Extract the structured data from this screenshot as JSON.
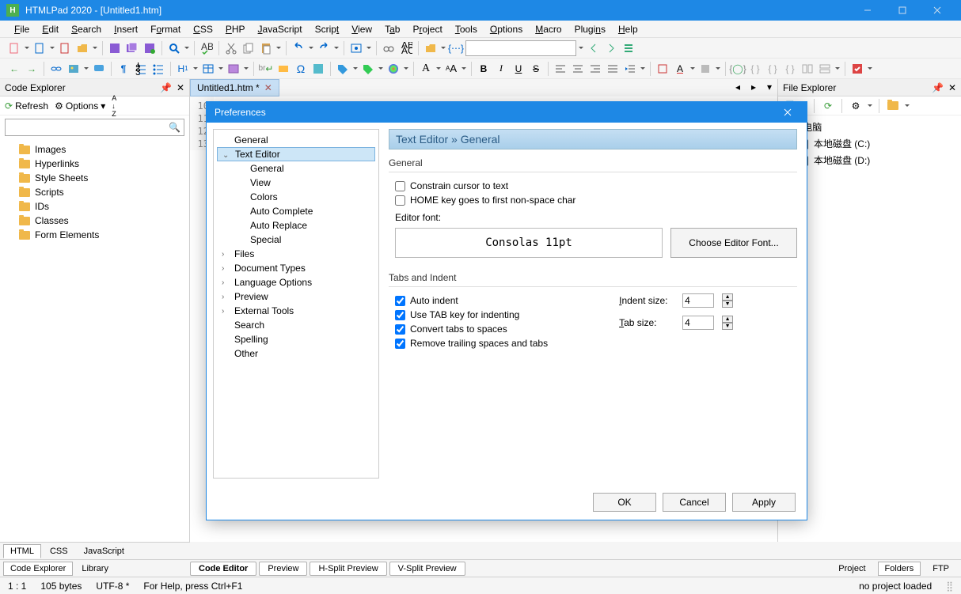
{
  "title": "HTMLPad 2020 - [Untitled1.htm]",
  "menu": [
    "File",
    "Edit",
    "Search",
    "Insert",
    "Format",
    "CSS",
    "PHP",
    "JavaScript",
    "Script",
    "View",
    "Tab",
    "Project",
    "Tools",
    "Options",
    "Macro",
    "Plugins",
    "Help"
  ],
  "code_explorer": {
    "title": "Code Explorer",
    "refresh": "Refresh",
    "options": "Options",
    "sort": "A↓Z",
    "items": [
      "Images",
      "Hyperlinks",
      "Style Sheets",
      "Scripts",
      "IDs",
      "Classes",
      "Form Elements"
    ]
  },
  "editor": {
    "tab": "Untitled1.htm *",
    "lines": [
      "10",
      "11",
      "12",
      "13"
    ]
  },
  "file_explorer": {
    "title": "File Explorer",
    "items": [
      "电脑",
      "本地磁盘 (C:)",
      "本地磁盘 (D:)"
    ]
  },
  "left_tabs": [
    "HTML",
    "CSS",
    "JavaScript"
  ],
  "left_subtabs": [
    "Code Explorer",
    "Library"
  ],
  "editor_tabs": [
    "Code Editor",
    "Preview",
    "H-Split Preview",
    "V-Split Preview"
  ],
  "right_tabs": [
    "Project",
    "Folders",
    "FTP"
  ],
  "status": {
    "pos": "1 : 1",
    "size": "105 bytes",
    "enc": "UTF-8 *",
    "hint": "For Help, press Ctrl+F1",
    "proj": "no project loaded"
  },
  "preferences": {
    "title": "Preferences",
    "crumb": "Text Editor » General",
    "tree": {
      "general": "General",
      "text_editor": "Text Editor",
      "te_children": [
        "General",
        "View",
        "Colors",
        "Auto Complete",
        "Auto Replace",
        "Special"
      ],
      "files": "Files",
      "doc_types": "Document Types",
      "lang_opts": "Language Options",
      "preview": "Preview",
      "ext_tools": "External Tools",
      "search": "Search",
      "spelling": "Spelling",
      "other": "Other"
    },
    "section_general": "General",
    "chk_constrain": "Constrain cursor to text",
    "chk_home": "HOME key goes to first non-space char",
    "editor_font_label": "Editor font:",
    "font_display": "Consolas 11pt",
    "choose_font_btn": "Choose Editor Font...",
    "section_tabs": "Tabs and Indent",
    "chk_autoindent": "Auto indent",
    "chk_usetab": "Use TAB key for indenting",
    "chk_convert": "Convert tabs to spaces",
    "chk_trailing": "Remove trailing spaces and tabs",
    "indent_label": "Indent size:",
    "indent_val": "4",
    "tab_label": "Tab size:",
    "tab_val": "4",
    "ok": "OK",
    "cancel": "Cancel",
    "apply": "Apply"
  }
}
